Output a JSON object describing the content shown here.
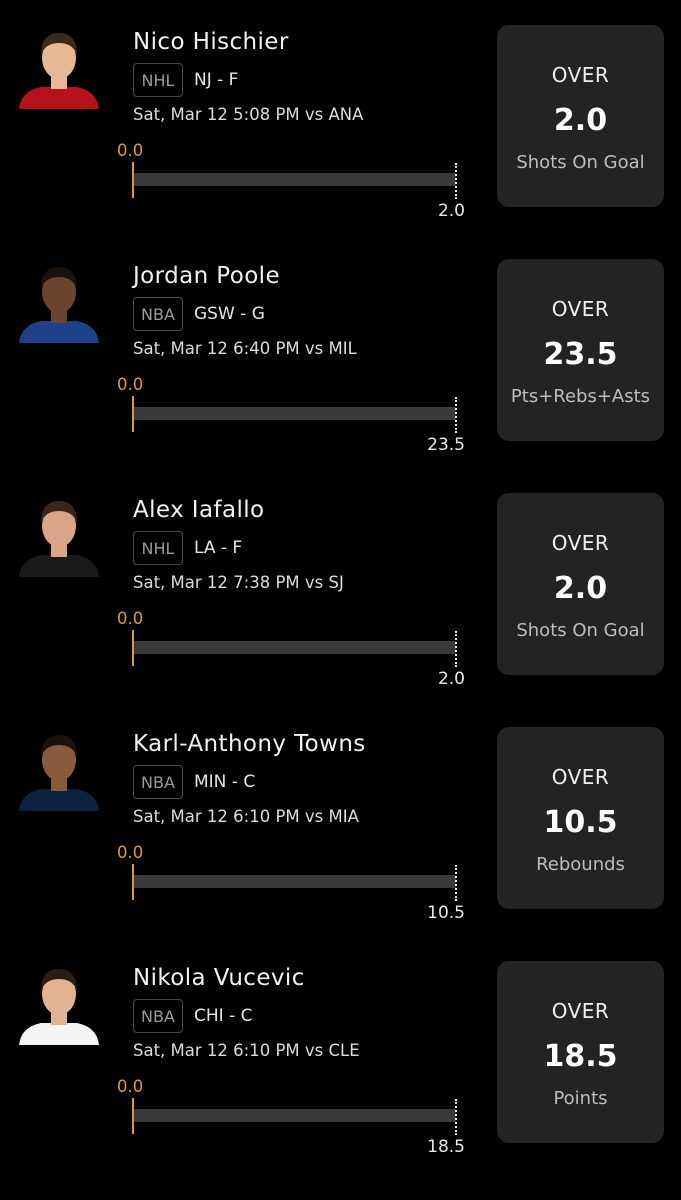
{
  "picks": [
    {
      "player": "Nico Hischier",
      "league": "NHL",
      "team_pos": "NJ - F",
      "game": "Sat, Mar 12 5:08 PM  vs ANA",
      "progress_start": "0.0",
      "progress_end": "2.0",
      "progress_fraction": 0,
      "direction": "OVER",
      "line": "2.0",
      "stat": "Shots On Goal",
      "avatar_icon": "player-headshot-icon",
      "jersey_color": "#b5121b",
      "skin_color": "#e8b896",
      "hair_color": "#3b2a1c"
    },
    {
      "player": "Jordan Poole",
      "league": "NBA",
      "team_pos": "GSW - G",
      "game": "Sat, Mar 12 6:40 PM  vs MIL",
      "progress_start": "0.0",
      "progress_end": "23.5",
      "progress_fraction": 0,
      "direction": "OVER",
      "line": "23.5",
      "stat": "Pts+Rebs+Asts",
      "avatar_icon": "player-headshot-icon",
      "jersey_color": "#1d428a",
      "skin_color": "#6b4430",
      "hair_color": "#1a120d"
    },
    {
      "player": "Alex Iafallo",
      "league": "NHL",
      "team_pos": "LA - F",
      "game": "Sat, Mar 12 7:38 PM  vs SJ",
      "progress_start": "0.0",
      "progress_end": "2.0",
      "progress_fraction": 0,
      "direction": "OVER",
      "line": "2.0",
      "stat": "Shots On Goal",
      "avatar_icon": "player-headshot-icon",
      "jersey_color": "#1a1a1a",
      "skin_color": "#d9a586",
      "hair_color": "#3a2618"
    },
    {
      "player": "Karl-Anthony Towns",
      "league": "NBA",
      "team_pos": "MIN - C",
      "game": "Sat, Mar 12 6:10 PM  vs MIA",
      "progress_start": "0.0",
      "progress_end": "10.5",
      "progress_fraction": 0,
      "direction": "OVER",
      "line": "10.5",
      "stat": "Rebounds",
      "avatar_icon": "player-headshot-icon",
      "jersey_color": "#0c2340",
      "skin_color": "#8a5a3c",
      "hair_color": "#1a120d"
    },
    {
      "player": "Nikola Vucevic",
      "league": "NBA",
      "team_pos": "CHI - C",
      "game": "Sat, Mar 12 6:10 PM  vs CLE",
      "progress_start": "0.0",
      "progress_end": "18.5",
      "progress_fraction": 0,
      "direction": "OVER",
      "line": "18.5",
      "stat": "Points",
      "avatar_icon": "player-headshot-icon",
      "jersey_color": "#f4f4f4",
      "skin_color": "#e2b393",
      "hair_color": "#2a1d14"
    }
  ]
}
